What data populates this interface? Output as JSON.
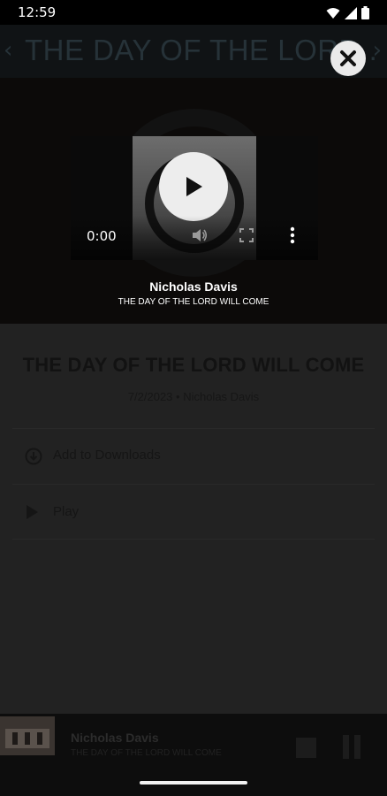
{
  "status": {
    "time": "12:59",
    "icons": [
      "wifi-icon",
      "signal-icon",
      "battery-icon"
    ]
  },
  "header": {
    "title": "THE DAY OF THE LORD . .",
    "back_icon": "chevron-left-icon",
    "next_icon": "chevron-right-icon"
  },
  "overlay": {
    "close_icon": "close-icon"
  },
  "video": {
    "time": "0:00",
    "play_icon": "play-icon",
    "volume_icon": "volume-icon",
    "fullscreen_icon": "fullscreen-icon",
    "more_icon": "more-vertical-icon"
  },
  "player": {
    "artist": "Nicholas Davis",
    "track": "THE DAY OF THE LORD WILL COME"
  },
  "sermon": {
    "title": "THE DAY OF THE LORD WILL COME",
    "meta": "7/2/2023 • Nicholas Davis",
    "actions": [
      {
        "label": "Add to Downloads",
        "icon": "download-icon"
      },
      {
        "label": "Play",
        "icon": "play-icon"
      }
    ]
  },
  "mini_player": {
    "artist": "Nicholas Davis",
    "track": "THE DAY OF THE LORD WILL COME",
    "stop_icon": "stop-icon",
    "pause_icon": "pause-icon"
  },
  "colors": {
    "background": "#1f1f1f",
    "header": "#101315",
    "accent": "#ffffff"
  }
}
